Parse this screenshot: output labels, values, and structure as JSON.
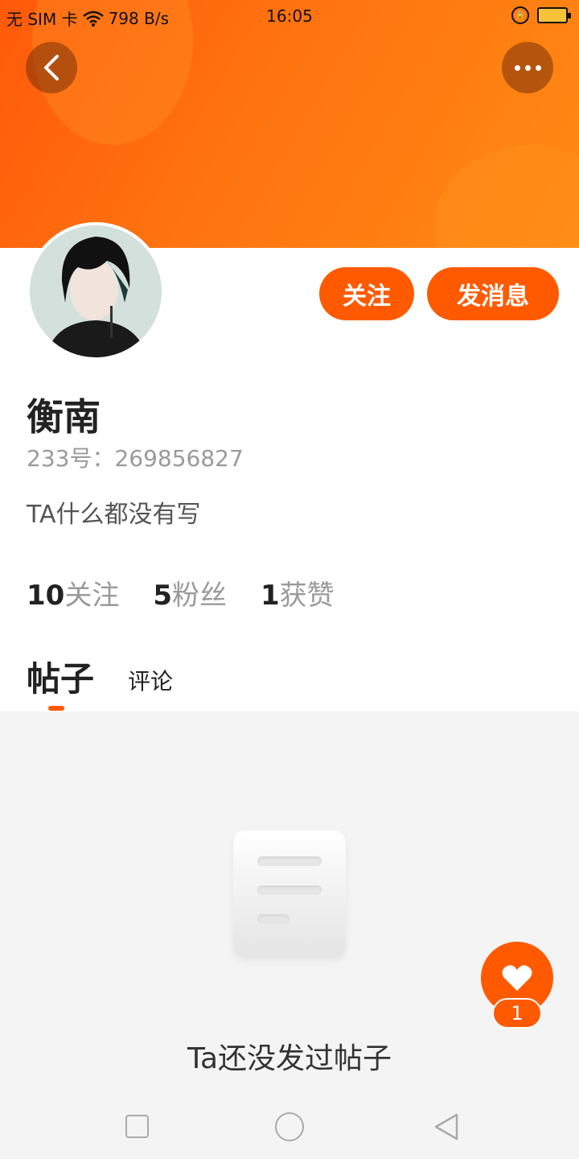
{
  "status_bar": {
    "carrier": "无 SIM 卡",
    "net_speed": "798 B/s",
    "time": "16:05"
  },
  "header": {
    "back_icon": "chevron-left-icon",
    "more_icon": "more-dots-icon",
    "banner_color": "#ff6a0c"
  },
  "profile": {
    "name": "衡南",
    "uid": "233号：269856827",
    "bio": "TA什么都没有写",
    "follow_label": "关注",
    "message_label": "发消息"
  },
  "stats": [
    {
      "value": "10",
      "label": "关注"
    },
    {
      "value": "5",
      "label": "粉丝"
    },
    {
      "value": "1",
      "label": "获赞"
    }
  ],
  "tabs": {
    "posts": "帖子",
    "comments": "评论"
  },
  "empty_state": {
    "message": "Ta还没发过帖子"
  },
  "like_fab": {
    "count": "1",
    "icon": "heart-icon"
  },
  "colors": {
    "accent": "#ff5a00",
    "content_bg": "#f4f4f4"
  }
}
